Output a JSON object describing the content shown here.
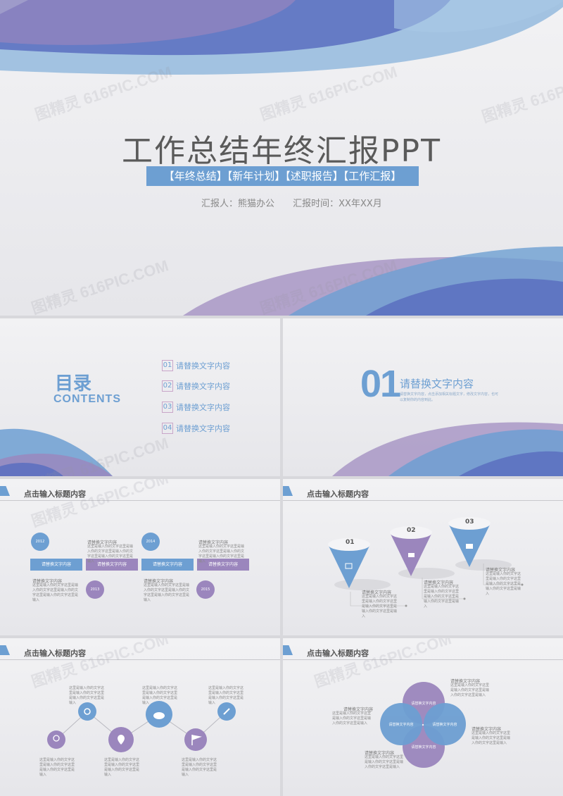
{
  "watermark": "图精灵 616PIC.COM",
  "colors": {
    "blue": "#6d9fd2",
    "purple": "#9b86bd",
    "deep_blue": "#5b6fc0"
  },
  "cover": {
    "title": "工作总结年终汇报PPT",
    "tags": "【年终总结】【新年计划】【述职报告】【工作汇报】",
    "reporter": "汇报人：熊猫办公",
    "report_time": "汇报时间：XX年XX月"
  },
  "toc": {
    "title": "目录",
    "subtitle": "CONTENTS",
    "items": [
      {
        "num": "01",
        "label": "请替换文字内容"
      },
      {
        "num": "02",
        "label": "请替换文字内容"
      },
      {
        "num": "03",
        "label": "请替换文字内容"
      },
      {
        "num": "04",
        "label": "请替换文字内容"
      }
    ]
  },
  "section": {
    "number": "01",
    "heading": "请替换文字内容",
    "description": "请替换文字内容，点击添加相关标题文字，修改文字内容，也可以复制你的内容到此。"
  },
  "slide3": {
    "header": "点击输入标题内容",
    "years": [
      "2012",
      "2013",
      "2014",
      "2015"
    ],
    "bar_label": "请替换文字内容",
    "note_title": "请替换文字内容",
    "note_text": "这里是输入你的文字这里是输入你的文字这里是输入你的文字这里是输入你的文字这里是输入"
  },
  "slide4": {
    "header": "点击输入标题内容",
    "cones": [
      "01",
      "02",
      "03"
    ],
    "note_title": "请替换文字内容",
    "note_text": "这里是输入你的文字这里是输入你的文字这里是输入你的文字这里是输入你的文字这里是输入"
  },
  "slide5": {
    "header": "点击输入标题内容",
    "note_text": "这里是输入你的文字这里是输入你的文字这里是输入你的文字这里是输入"
  },
  "slide6": {
    "header": "点击输入标题内容",
    "circle_label": "请替换文字内容",
    "note_title": "请替换文字内容",
    "note_text": "这里是输入你的文字这里是输入你的文字这里是输入你的文字这里是输入"
  }
}
